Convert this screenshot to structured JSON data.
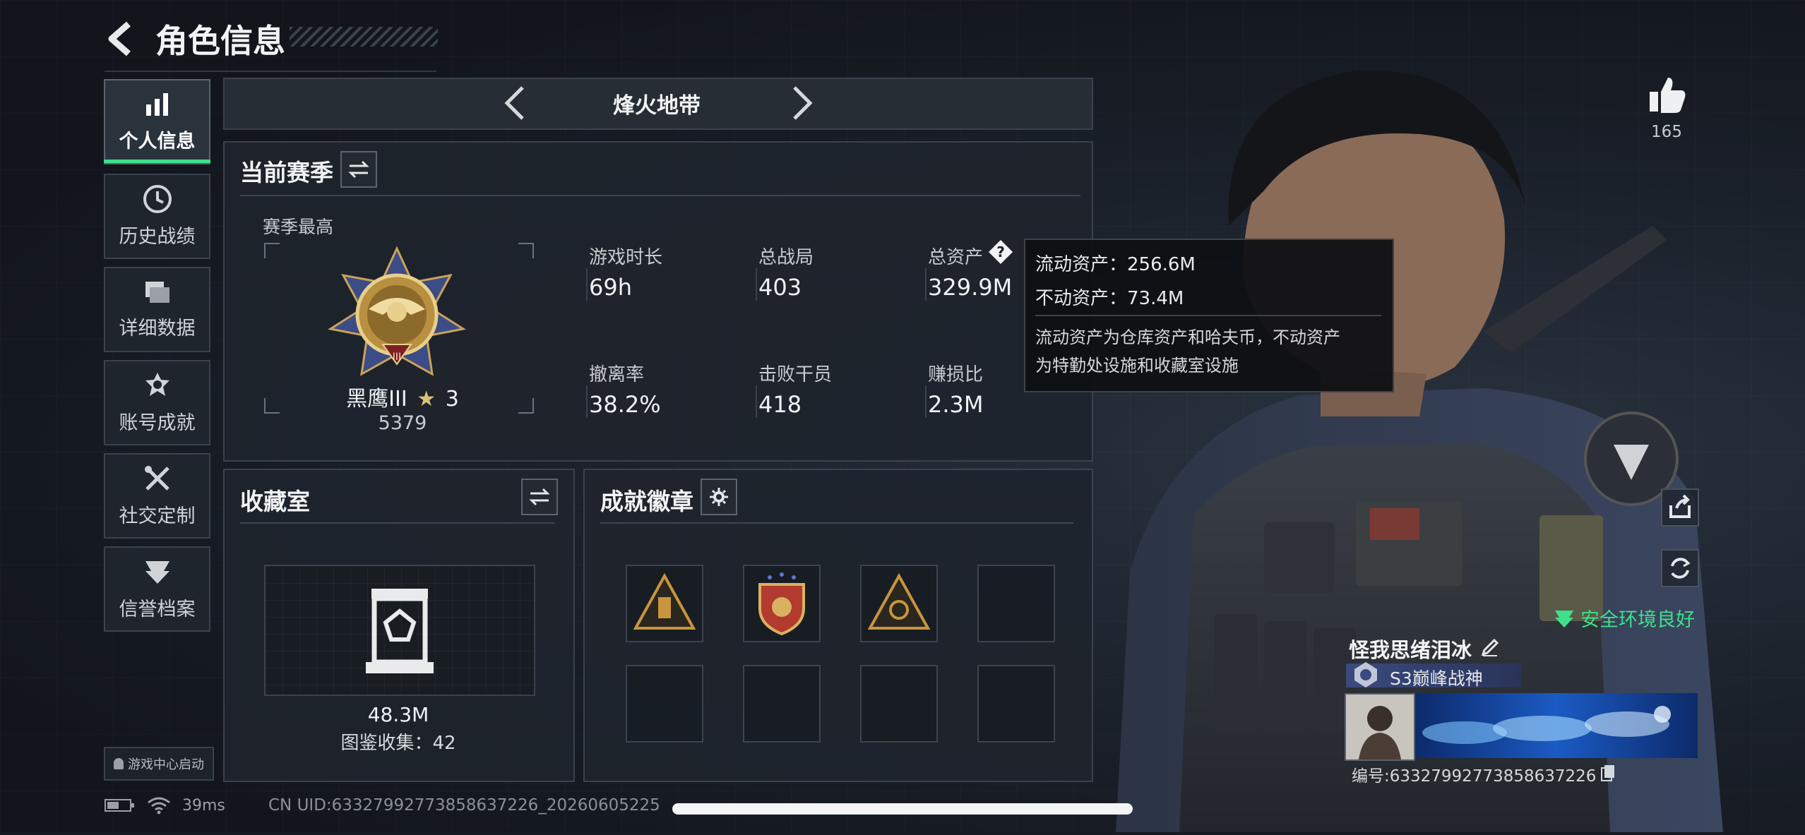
{
  "header": {
    "title": "角色信息"
  },
  "sidebar": {
    "items": [
      {
        "label": "个人信息",
        "icon": "bar-chart-icon"
      },
      {
        "label": "历史战绩",
        "icon": "clock-icon"
      },
      {
        "label": "详细数据",
        "icon": "folder-icon"
      },
      {
        "label": "账号成就",
        "icon": "medal-icon"
      },
      {
        "label": "社交定制",
        "icon": "tools-icon"
      },
      {
        "label": "信誉档案",
        "icon": "shield-icon"
      }
    ],
    "game_center_label": "游戏中心启动"
  },
  "mode_selector": {
    "label": "烽火地带"
  },
  "season": {
    "title": "当前赛季",
    "best_label": "赛季最高",
    "rank_name": "黑鹰III",
    "rank_stars": "3",
    "rank_score": "5379",
    "stats": [
      {
        "label": "游戏时长",
        "value": "69h"
      },
      {
        "label": "总战局",
        "value": "403"
      },
      {
        "label": "总资产",
        "value": "329.9M"
      },
      {
        "label": "撤离率",
        "value": "38.2%"
      },
      {
        "label": "击败干员",
        "value": "418"
      },
      {
        "label": "赚损比",
        "value": "2.3M"
      }
    ]
  },
  "tooltip": {
    "liquid": "流动资产：256.6M",
    "fixed": "不动资产：73.4M",
    "desc_line1": "流动资产为仓库资产和哈夫币，不动资产",
    "desc_line2": "为特勤处设施和收藏室设施"
  },
  "collection": {
    "title": "收藏室",
    "value": "48.3M",
    "count_text": "图鉴收集：42"
  },
  "badges": {
    "title": "成就徽章",
    "slots_total": 8,
    "slots_filled": 3
  },
  "right": {
    "likes": "165",
    "safety": "安全环境良好",
    "player_name": "怪我思绪泪冰",
    "player_title": "S3巅峰战神",
    "player_id": "编号:6332799277385863722​6"
  },
  "statusbar": {
    "ping": "39ms",
    "uid": "CN UID:633279927738586372​26_20260605225"
  },
  "colors": {
    "accent": "#3ee08a",
    "bg": "#161b22",
    "panel": "#1e242c"
  }
}
